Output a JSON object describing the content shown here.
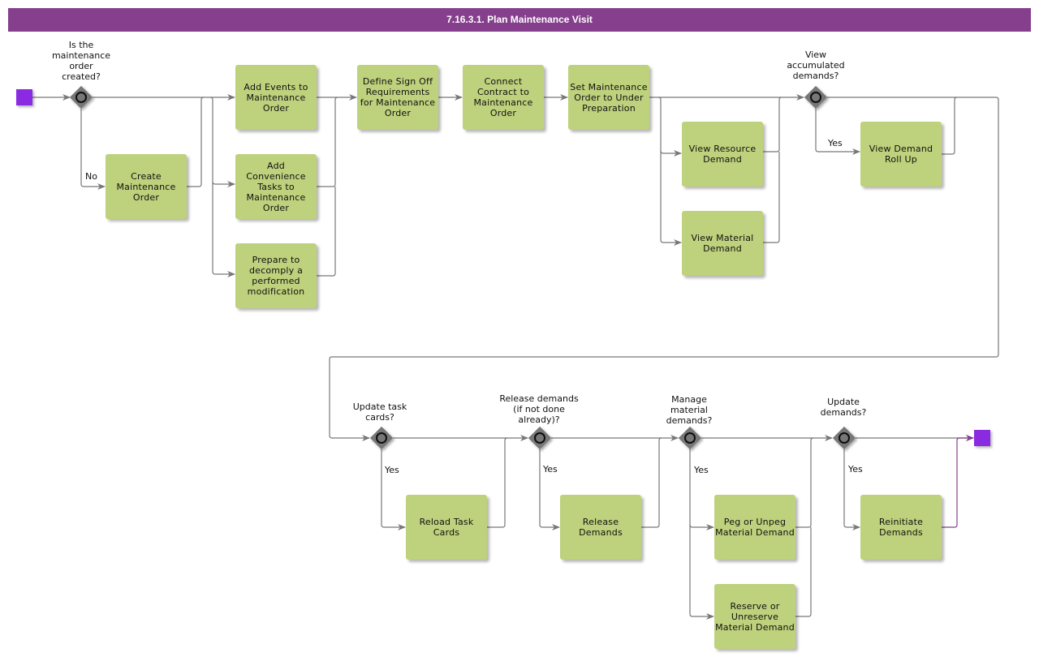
{
  "title": "7.16.3.1. Plan Maintenance Visit",
  "colors": {
    "title_bar": "#853f8c",
    "task_fill": "#bed17c",
    "event_fill": "#8a2be2",
    "gateway_fill": "#777777",
    "connector": "#777777",
    "end_connector": "#853f8c"
  },
  "events": {
    "start": {
      "type": "start-event"
    },
    "end": {
      "type": "end-event"
    }
  },
  "gateways": [
    {
      "id": "g1",
      "label": "Is the\nmaintenance\norder\ncreated?"
    },
    {
      "id": "g2",
      "label": "View\naccumulated\ndemands?"
    },
    {
      "id": "g3",
      "label": "Update task\ncards?"
    },
    {
      "id": "g4",
      "label": "Release demands\n(if not done\nalready)?"
    },
    {
      "id": "g5",
      "label": "Manage\nmaterial\ndemands?"
    },
    {
      "id": "g6",
      "label": "Update\ndemands?"
    }
  ],
  "tasks": [
    {
      "id": "t1",
      "label": "Create Maintenance Order"
    },
    {
      "id": "t2",
      "label": "Add Events to Maintenance Order"
    },
    {
      "id": "t3",
      "label": "Add Convenience Tasks to Maintenance Order"
    },
    {
      "id": "t4",
      "label": "Prepare to decomply a performed modification"
    },
    {
      "id": "t5",
      "label": "Define Sign Off Requirements for Maintenance Order"
    },
    {
      "id": "t6",
      "label": "Connect Contract to Maintenance Order"
    },
    {
      "id": "t7",
      "label": "Set Maintenance Order to Under Preparation"
    },
    {
      "id": "t8",
      "label": "View Resource Demand"
    },
    {
      "id": "t9",
      "label": "View Material Demand"
    },
    {
      "id": "t10",
      "label": "View Demand Roll Up"
    },
    {
      "id": "t11",
      "label": "Reload Task Cards"
    },
    {
      "id": "t12",
      "label": "Release Demands"
    },
    {
      "id": "t13",
      "label": "Peg or Unpeg Material Demand"
    },
    {
      "id": "t14",
      "label": "Reserve or Unreserve Material Demand"
    },
    {
      "id": "t15",
      "label": "Reinitiate Demands"
    }
  ],
  "flow_labels": {
    "no": "No",
    "yes1": "Yes",
    "yes2": "Yes",
    "yes3": "Yes",
    "yes4": "Yes",
    "yes5": "Yes"
  }
}
